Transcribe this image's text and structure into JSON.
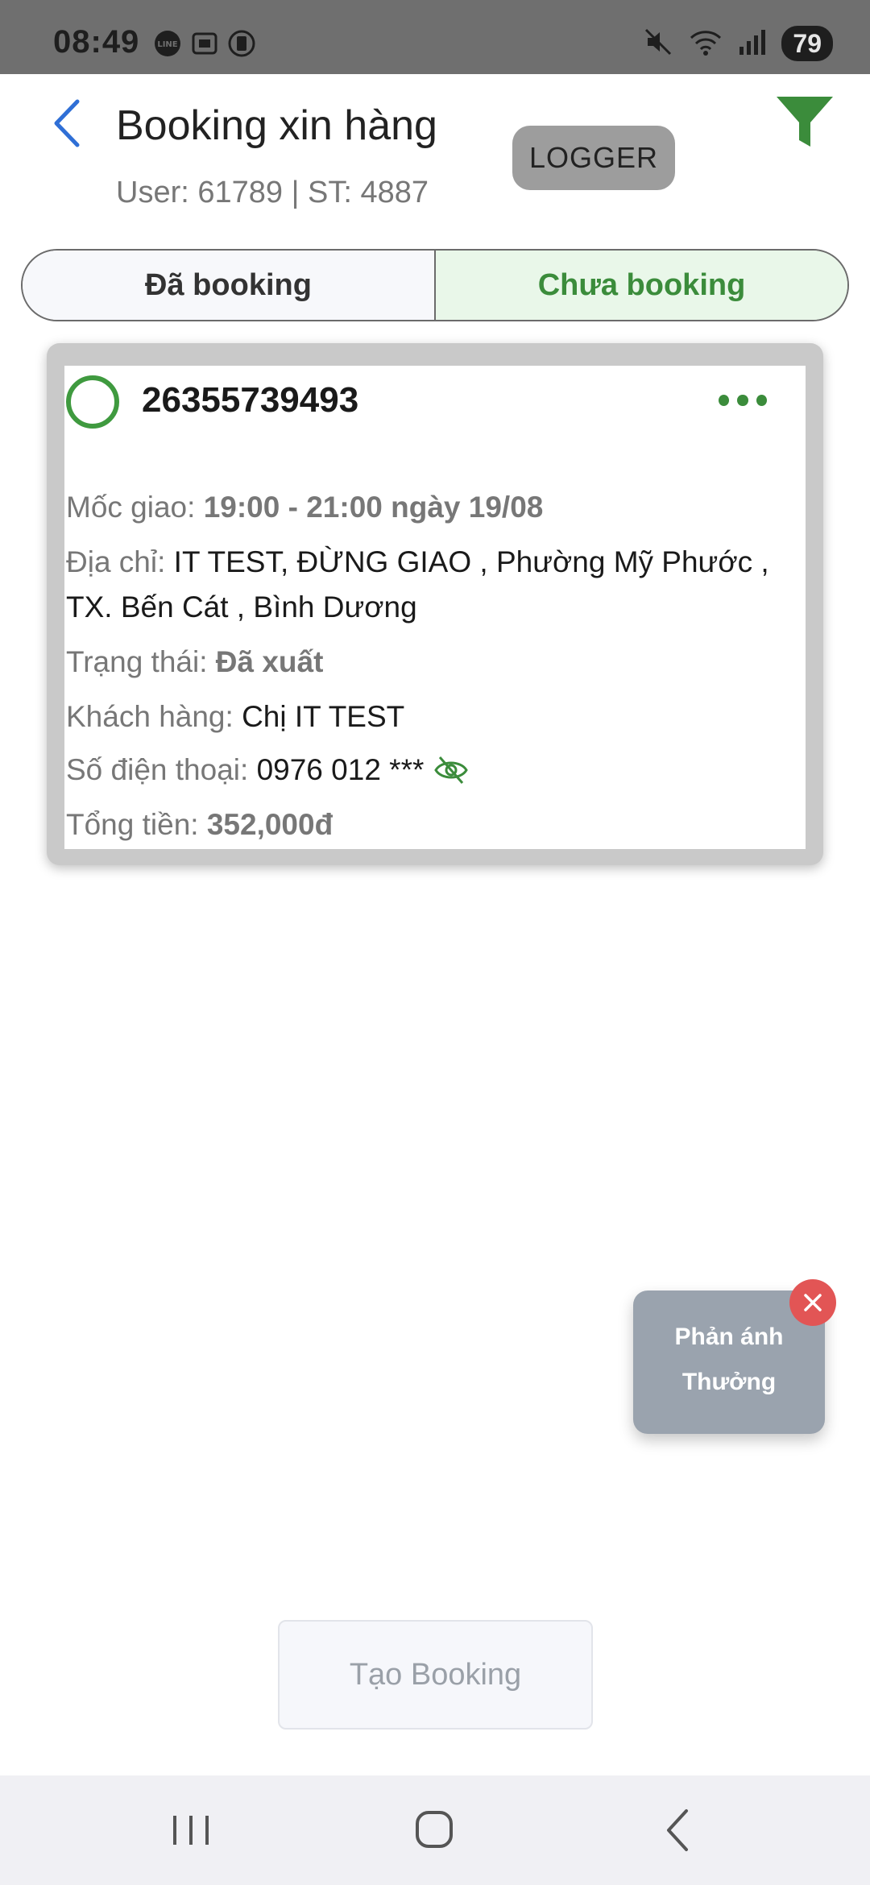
{
  "status_bar": {
    "time": "08:49",
    "battery": "79",
    "icons_left": [
      "line-app-icon",
      "screenshot-icon",
      "storage-icon"
    ],
    "icons_right": [
      "mute-icon",
      "wifi-icon",
      "signal-icon"
    ]
  },
  "header": {
    "title": "Booking xin hàng",
    "subtitle": "User: 61789 | ST: 4887",
    "logger_label": "LOGGER"
  },
  "tabs": [
    {
      "label": "Đã booking",
      "active": false
    },
    {
      "label": "Chưa booking",
      "active": true
    }
  ],
  "card": {
    "order_id": "26355739493",
    "time_label": "Mốc giao:",
    "time_value": "19:00 - 21:00 ngày 19/08",
    "address_label": "Địa chỉ:",
    "address_value": "IT TEST, ĐỪNG GIAO , Phường Mỹ Phước , TX. Bến Cát , Bình Dương",
    "status_label": "Trạng thái:",
    "status_value": "Đã xuất",
    "customer_label": "Khách hàng:",
    "customer_value": "Chị IT TEST",
    "phone_label": "Số điện thoại:",
    "phone_value": "0976 012 ***",
    "total_label": "Tổng tiền:",
    "total_value": "352,000đ"
  },
  "feedback": {
    "line1": "Phản ánh",
    "line2": "Thưởng"
  },
  "create_button_label": "Tạo Booking",
  "colors": {
    "accent_green": "#3b8c3b",
    "active_tab_bg": "#e9f7e9",
    "back_blue": "#2f6fd6",
    "close_red": "#e25555",
    "feedback_bg": "#9aa3ae"
  }
}
